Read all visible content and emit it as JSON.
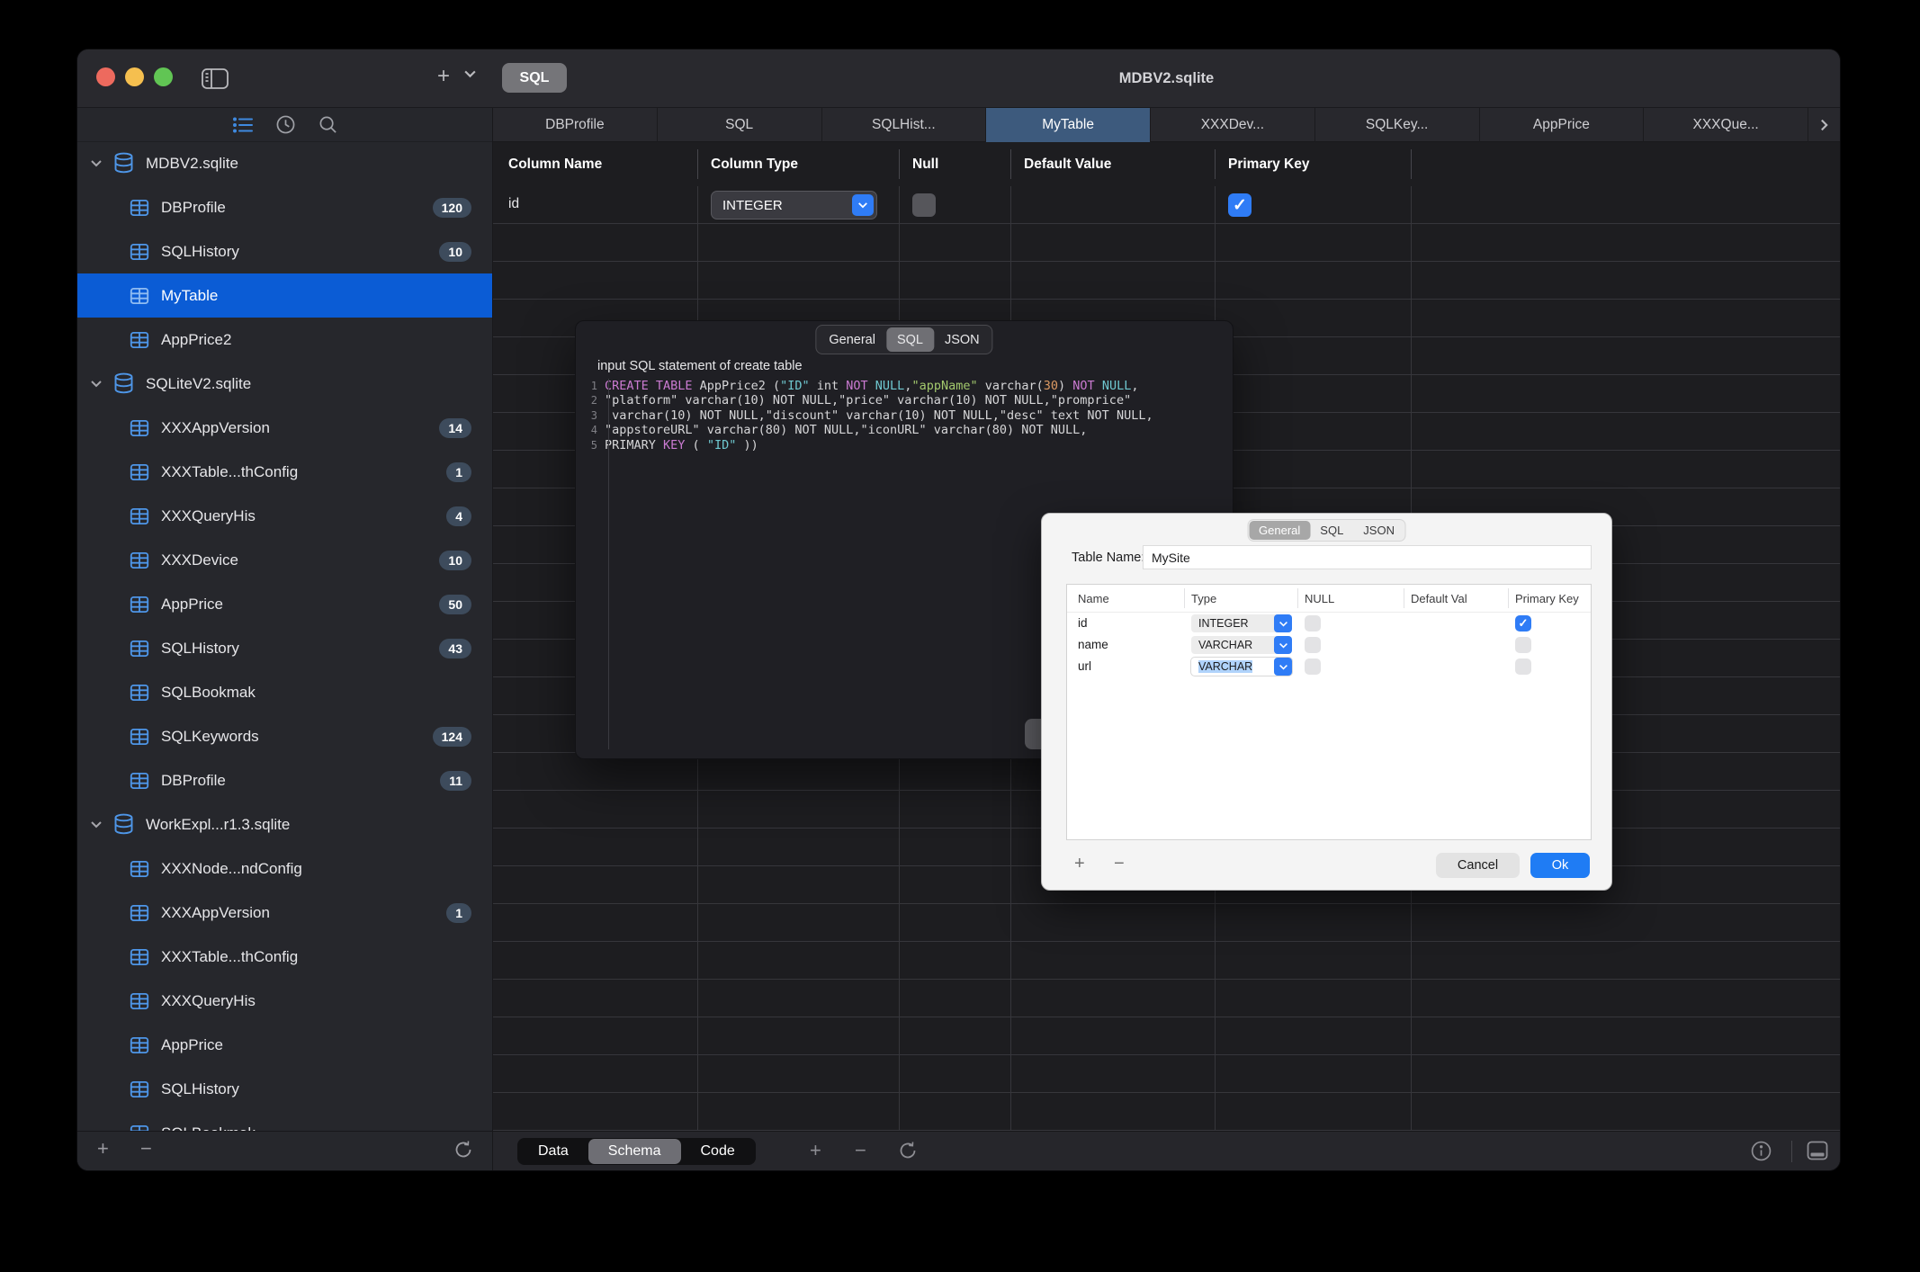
{
  "colors": {
    "selection_blue": "#0b5cd5",
    "control_blue": "#2f7cf6",
    "tab_active": "#3d5a7d",
    "ok_button": "#1f7cf4",
    "badge_bg": "#3d4b5c",
    "traffic_red": "#ed6a5e",
    "traffic_yellow": "#f5bf4f",
    "traffic_green": "#61c554",
    "code_keyword": "#cb7bd2",
    "code_string": "#6fc8d0",
    "code_field": "#a3c96d",
    "code_number": "#dd9a63",
    "code_plain": "#d6d6d8"
  },
  "icons": {
    "plus": "+",
    "minus": "−",
    "check": "✓"
  },
  "window": {
    "title": "MDBV2.sqlite"
  },
  "titlebar": {
    "sql_chip": "SQL"
  },
  "sidebar": {
    "tree": [
      {
        "kind": "database",
        "label": "MDBV2.sqlite",
        "expanded": true
      },
      {
        "kind": "table",
        "label": "DBProfile",
        "badge": "120"
      },
      {
        "kind": "table",
        "label": "SQLHistory",
        "badge": "10"
      },
      {
        "kind": "table",
        "label": "MyTable",
        "selected": true
      },
      {
        "kind": "table",
        "label": "AppPrice2"
      },
      {
        "kind": "database",
        "label": "SQLiteV2.sqlite",
        "expanded": true
      },
      {
        "kind": "table",
        "label": "XXXAppVersion",
        "badge": "14"
      },
      {
        "kind": "table",
        "label": "XXXTable...thConfig",
        "badge": "1"
      },
      {
        "kind": "table",
        "label": "XXXQueryHis",
        "badge": "4"
      },
      {
        "kind": "table",
        "label": "XXXDevice",
        "badge": "10"
      },
      {
        "kind": "table",
        "label": "AppPrice",
        "badge": "50"
      },
      {
        "kind": "table",
        "label": "SQLHistory",
        "badge": "43"
      },
      {
        "kind": "table",
        "label": "SQLBookmak"
      },
      {
        "kind": "table",
        "label": "SQLKeywords",
        "badge": "124"
      },
      {
        "kind": "table",
        "label": "DBProfile",
        "badge": "11"
      },
      {
        "kind": "database",
        "label": "WorkExpl...r1.3.sqlite",
        "expanded": true
      },
      {
        "kind": "table",
        "label": "XXXNode...ndConfig"
      },
      {
        "kind": "table",
        "label": "XXXAppVersion",
        "badge": "1"
      },
      {
        "kind": "table",
        "label": "XXXTable...thConfig"
      },
      {
        "kind": "table",
        "label": "XXXQueryHis"
      },
      {
        "kind": "table",
        "label": "AppPrice"
      },
      {
        "kind": "table",
        "label": "SQLHistory"
      },
      {
        "kind": "table",
        "label": "SQLBookmak"
      }
    ]
  },
  "tabs": {
    "items": [
      "DBProfile",
      "SQL",
      "SQLHist...",
      "MyTable",
      "XXXDev...",
      "SQLKey...",
      "AppPrice",
      "XXXQue..."
    ],
    "active_index": 3
  },
  "schema_table": {
    "headers": [
      "Column Name",
      "Column Type",
      "Null",
      "Default Value",
      "Primary Key"
    ],
    "rows": [
      {
        "name": "id",
        "type": "INTEGER",
        "null": false,
        "default": "",
        "primary_key": true
      }
    ],
    "empty_row_count": 24
  },
  "bottom_bar": {
    "segments": [
      "Data",
      "Schema",
      "Code"
    ],
    "active_index": 1
  },
  "sql_panel": {
    "tabs": [
      "General",
      "SQL",
      "JSON"
    ],
    "active_tab": "SQL",
    "label": "input SQL statement of create table",
    "code_lines": [
      [
        [
          "k",
          "CREATE TABLE"
        ],
        [
          "p",
          " AppPrice2 ("
        ],
        [
          "s",
          "\"ID\""
        ],
        [
          "p",
          " int "
        ],
        [
          "k",
          "NOT"
        ],
        [
          "p",
          " "
        ],
        [
          "s",
          "NULL"
        ],
        [
          "p",
          ","
        ],
        [
          "g",
          "\"appName\""
        ],
        [
          "p",
          " varchar("
        ],
        [
          "n",
          "30"
        ],
        [
          "p",
          ") "
        ],
        [
          "k",
          "NOT"
        ],
        [
          "p",
          " "
        ],
        [
          "s",
          "NULL"
        ],
        [
          "p",
          ","
        ]
      ],
      [
        [
          "p",
          "\"platform\" varchar(10) NOT NULL,\"price\" varchar(10) NOT NULL,\"promprice\""
        ]
      ],
      [
        [
          "p",
          " varchar(10) NOT NULL,\"discount\" varchar(10) NOT NULL,\"desc\" text NOT NULL,"
        ]
      ],
      [
        [
          "p",
          "\"appstoreURL\" varchar(80) NOT NULL,\"iconURL\" varchar(80) NOT NULL,"
        ]
      ],
      [
        [
          "p",
          "PRIMARY "
        ],
        [
          "k",
          "KEY"
        ],
        [
          "p",
          " ( "
        ],
        [
          "s",
          "\"ID\""
        ],
        [
          "p",
          " ))"
        ]
      ]
    ]
  },
  "dialog": {
    "tabs": [
      "General",
      "SQL",
      "JSON"
    ],
    "active_tab": "General",
    "table_name_label": "Table Name:",
    "table_name_value": "MySite",
    "grid_headers": [
      "Name",
      "Type",
      "NULL",
      "Default Val",
      "Primary Key"
    ],
    "rows": [
      {
        "name": "id",
        "type": "INTEGER",
        "null": false,
        "default": "",
        "primary_key": true,
        "type_text_selected": false
      },
      {
        "name": "name",
        "type": "VARCHAR",
        "null": false,
        "default": "",
        "primary_key": false,
        "type_text_selected": false
      },
      {
        "name": "url",
        "type": "VARCHAR",
        "null": false,
        "default": "",
        "primary_key": false,
        "type_text_selected": true
      }
    ],
    "cancel_label": "Cancel",
    "ok_label": "Ok"
  }
}
